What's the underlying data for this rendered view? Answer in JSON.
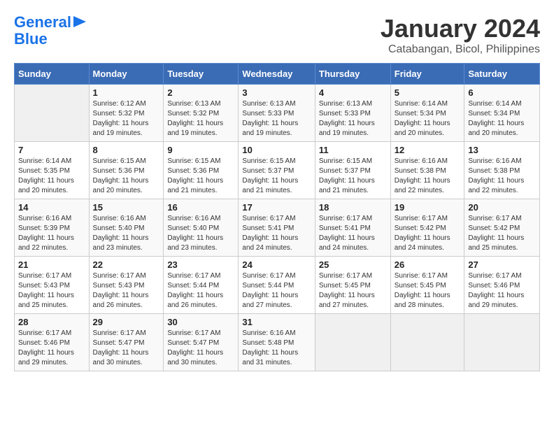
{
  "logo": {
    "line1": "General",
    "line2": "Blue"
  },
  "title": "January 2024",
  "subtitle": "Catabangan, Bicol, Philippines",
  "headers": [
    "Sunday",
    "Monday",
    "Tuesday",
    "Wednesday",
    "Thursday",
    "Friday",
    "Saturday"
  ],
  "weeks": [
    [
      {
        "day": "",
        "info": ""
      },
      {
        "day": "1",
        "info": "Sunrise: 6:12 AM\nSunset: 5:32 PM\nDaylight: 11 hours\nand 19 minutes."
      },
      {
        "day": "2",
        "info": "Sunrise: 6:13 AM\nSunset: 5:32 PM\nDaylight: 11 hours\nand 19 minutes."
      },
      {
        "day": "3",
        "info": "Sunrise: 6:13 AM\nSunset: 5:33 PM\nDaylight: 11 hours\nand 19 minutes."
      },
      {
        "day": "4",
        "info": "Sunrise: 6:13 AM\nSunset: 5:33 PM\nDaylight: 11 hours\nand 19 minutes."
      },
      {
        "day": "5",
        "info": "Sunrise: 6:14 AM\nSunset: 5:34 PM\nDaylight: 11 hours\nand 20 minutes."
      },
      {
        "day": "6",
        "info": "Sunrise: 6:14 AM\nSunset: 5:34 PM\nDaylight: 11 hours\nand 20 minutes."
      }
    ],
    [
      {
        "day": "7",
        "info": "Sunrise: 6:14 AM\nSunset: 5:35 PM\nDaylight: 11 hours\nand 20 minutes."
      },
      {
        "day": "8",
        "info": "Sunrise: 6:15 AM\nSunset: 5:36 PM\nDaylight: 11 hours\nand 20 minutes."
      },
      {
        "day": "9",
        "info": "Sunrise: 6:15 AM\nSunset: 5:36 PM\nDaylight: 11 hours\nand 21 minutes."
      },
      {
        "day": "10",
        "info": "Sunrise: 6:15 AM\nSunset: 5:37 PM\nDaylight: 11 hours\nand 21 minutes."
      },
      {
        "day": "11",
        "info": "Sunrise: 6:15 AM\nSunset: 5:37 PM\nDaylight: 11 hours\nand 21 minutes."
      },
      {
        "day": "12",
        "info": "Sunrise: 6:16 AM\nSunset: 5:38 PM\nDaylight: 11 hours\nand 22 minutes."
      },
      {
        "day": "13",
        "info": "Sunrise: 6:16 AM\nSunset: 5:38 PM\nDaylight: 11 hours\nand 22 minutes."
      }
    ],
    [
      {
        "day": "14",
        "info": "Sunrise: 6:16 AM\nSunset: 5:39 PM\nDaylight: 11 hours\nand 22 minutes."
      },
      {
        "day": "15",
        "info": "Sunrise: 6:16 AM\nSunset: 5:40 PM\nDaylight: 11 hours\nand 23 minutes."
      },
      {
        "day": "16",
        "info": "Sunrise: 6:16 AM\nSunset: 5:40 PM\nDaylight: 11 hours\nand 23 minutes."
      },
      {
        "day": "17",
        "info": "Sunrise: 6:17 AM\nSunset: 5:41 PM\nDaylight: 11 hours\nand 24 minutes."
      },
      {
        "day": "18",
        "info": "Sunrise: 6:17 AM\nSunset: 5:41 PM\nDaylight: 11 hours\nand 24 minutes."
      },
      {
        "day": "19",
        "info": "Sunrise: 6:17 AM\nSunset: 5:42 PM\nDaylight: 11 hours\nand 24 minutes."
      },
      {
        "day": "20",
        "info": "Sunrise: 6:17 AM\nSunset: 5:42 PM\nDaylight: 11 hours\nand 25 minutes."
      }
    ],
    [
      {
        "day": "21",
        "info": "Sunrise: 6:17 AM\nSunset: 5:43 PM\nDaylight: 11 hours\nand 25 minutes."
      },
      {
        "day": "22",
        "info": "Sunrise: 6:17 AM\nSunset: 5:43 PM\nDaylight: 11 hours\nand 26 minutes."
      },
      {
        "day": "23",
        "info": "Sunrise: 6:17 AM\nSunset: 5:44 PM\nDaylight: 11 hours\nand 26 minutes."
      },
      {
        "day": "24",
        "info": "Sunrise: 6:17 AM\nSunset: 5:44 PM\nDaylight: 11 hours\nand 27 minutes."
      },
      {
        "day": "25",
        "info": "Sunrise: 6:17 AM\nSunset: 5:45 PM\nDaylight: 11 hours\nand 27 minutes."
      },
      {
        "day": "26",
        "info": "Sunrise: 6:17 AM\nSunset: 5:45 PM\nDaylight: 11 hours\nand 28 minutes."
      },
      {
        "day": "27",
        "info": "Sunrise: 6:17 AM\nSunset: 5:46 PM\nDaylight: 11 hours\nand 29 minutes."
      }
    ],
    [
      {
        "day": "28",
        "info": "Sunrise: 6:17 AM\nSunset: 5:46 PM\nDaylight: 11 hours\nand 29 minutes."
      },
      {
        "day": "29",
        "info": "Sunrise: 6:17 AM\nSunset: 5:47 PM\nDaylight: 11 hours\nand 30 minutes."
      },
      {
        "day": "30",
        "info": "Sunrise: 6:17 AM\nSunset: 5:47 PM\nDaylight: 11 hours\nand 30 minutes."
      },
      {
        "day": "31",
        "info": "Sunrise: 6:16 AM\nSunset: 5:48 PM\nDaylight: 11 hours\nand 31 minutes."
      },
      {
        "day": "",
        "info": ""
      },
      {
        "day": "",
        "info": ""
      },
      {
        "day": "",
        "info": ""
      }
    ]
  ]
}
